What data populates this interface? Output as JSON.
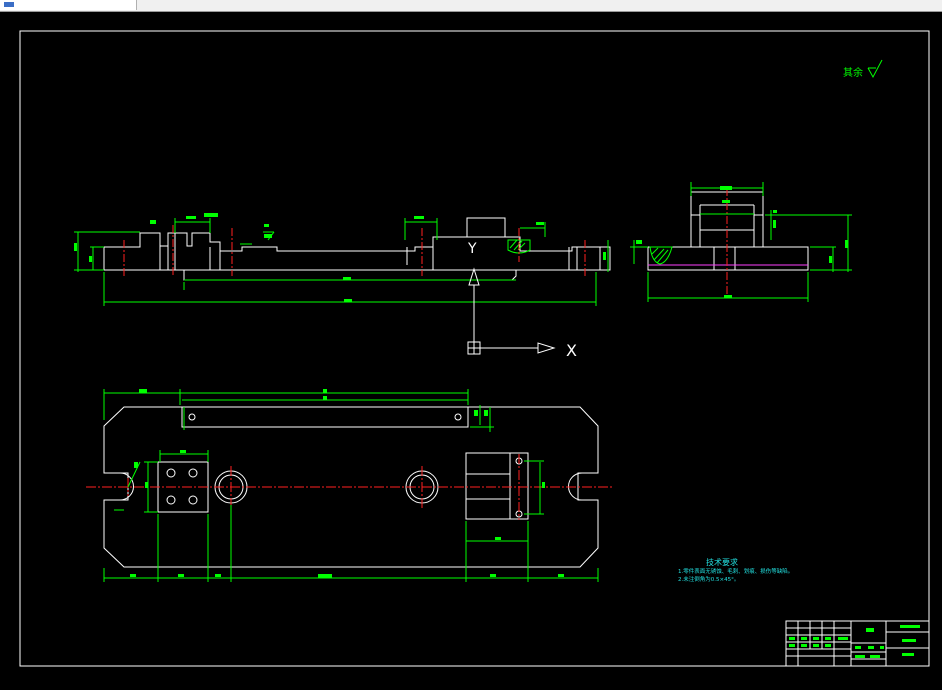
{
  "window": {
    "tab_icon": "app-icon"
  },
  "drawing": {
    "surface_finish_note": "其余",
    "technical_requirements": {
      "title": "技术要求",
      "lines": [
        "1.零件表面无锈蚀、毛刺、划痕、损伤等缺陷。",
        "2.未注倒角为0.5×45°。"
      ]
    },
    "ucs": {
      "x_label": "X",
      "y_label": "Y"
    }
  },
  "colors": {
    "background": "#000000",
    "outline": "#ffffff",
    "dimension": "#00ff00",
    "centerline": "#ff2020",
    "hidden": "#ff40ff",
    "note": "#22e0e0"
  }
}
